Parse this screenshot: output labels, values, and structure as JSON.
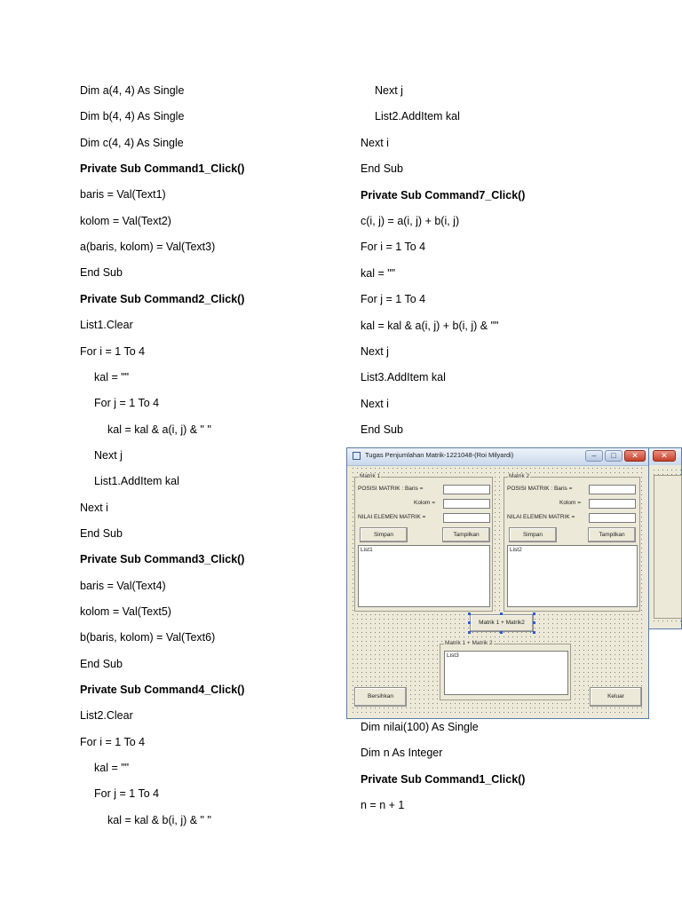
{
  "code_left": [
    {
      "text": "Dim a(4, 4) As Single",
      "bold": false
    },
    {
      "text": "Dim b(4, 4) As Single",
      "bold": false
    },
    {
      "text": "Dim c(4, 4) As Single",
      "bold": false
    },
    {
      "text": "Private Sub Command1_Click()",
      "bold": true
    },
    {
      "text": "baris = Val(Text1)",
      "bold": false
    },
    {
      "text": "kolom = Val(Text2)",
      "bold": false
    },
    {
      "text": "a(baris, kolom) = Val(Text3)",
      "bold": false
    },
    {
      "text": "End Sub",
      "bold": false
    },
    {
      "text": "Private Sub Command2_Click()",
      "bold": true
    },
    {
      "text": "List1.Clear",
      "bold": false
    },
    {
      "text": "For i = 1 To 4",
      "bold": false
    },
    {
      "text": "kal = \"\"",
      "bold": false
    },
    {
      "text": "For j = 1 To 4",
      "bold": false
    },
    {
      "text": "kal = kal & a(i, j) & \" \"",
      "bold": false
    },
    {
      "text": "Next j",
      "bold": false
    },
    {
      "text": "List1.AddItem kal",
      "bold": false
    },
    {
      "text": "Next i",
      "bold": false
    },
    {
      "text": "End Sub",
      "bold": false
    },
    {
      "text": "Private Sub Command3_Click()",
      "bold": true
    },
    {
      "text": "baris = Val(Text4)",
      "bold": false
    },
    {
      "text": "kolom = Val(Text5)",
      "bold": false
    },
    {
      "text": "b(baris, kolom) = Val(Text6)",
      "bold": false
    },
    {
      "text": "End Sub",
      "bold": false
    },
    {
      "text": "Private Sub Command4_Click()",
      "bold": true
    },
    {
      "text": "List2.Clear",
      "bold": false
    },
    {
      "text": "For i = 1 To 4",
      "bold": false
    },
    {
      "text": "kal = \"\"",
      "bold": false
    },
    {
      "text": "For j = 1 To 4",
      "bold": false
    },
    {
      "text": "kal = kal & b(i, j) & \" \"",
      "bold": false
    }
  ],
  "code_right_top": [
    {
      "text": "Next j",
      "bold": false
    },
    {
      "text": "List2.AddItem kal",
      "bold": false
    },
    {
      "text": "Next i",
      "bold": false
    },
    {
      "text": "End Sub",
      "bold": false
    },
    {
      "text": "Private Sub Command7_Click()",
      "bold": true
    },
    {
      "text": "c(i, j) = a(i, j) + b(i, j)",
      "bold": false
    },
    {
      "text": "For i = 1 To 4",
      "bold": false
    },
    {
      "text": "kal = \"\"",
      "bold": false
    },
    {
      "text": "For j = 1 To 4",
      "bold": false
    },
    {
      "text": "kal = kal & a(i, j) + b(i, j) & \"\"",
      "bold": false
    },
    {
      "text": "Next j",
      "bold": false
    },
    {
      "text": "List3.AddItem kal",
      "bold": false
    },
    {
      "text": "Next i",
      "bold": false
    },
    {
      "text": "End Sub",
      "bold": false
    }
  ],
  "code_right_bottom": [
    {
      "text": "Dim nilai(100) As Single",
      "bold": false
    },
    {
      "text": "Dim n As Integer",
      "bold": false
    },
    {
      "text": "Private Sub Command1_Click()",
      "bold": true
    },
    {
      "text": "n = n + 1",
      "bold": false
    }
  ],
  "form": {
    "title": "Tugas Penjumlahan Matrik-1221048-(Roi Milyardi)",
    "min_glyph": "–",
    "max_glyph": "□",
    "close_glyph": "✕",
    "matrix1": {
      "frame": "Matrik 1",
      "pos_label": "POSISI MATRIK : Baris  =",
      "kolom_label": "Kolom =",
      "nilai_label": "NILAI ELEMEN MATRIK =",
      "save": "Simpan",
      "show": "Tampilkan",
      "list": "List1"
    },
    "matrix2": {
      "frame": "Matrik 2",
      "pos_label": "POSISI MATRIK : Baris  =",
      "kolom_label": "Kolom =",
      "nilai_label": "NILAI ELEMEN MATRIK =",
      "save": "Simpan",
      "show": "Tampilkan",
      "list": "List2"
    },
    "add_button": "Matrik 1 + Matrik2",
    "result": {
      "frame": "Matrik 1 + Matrik 2",
      "list": "List3"
    },
    "clear_button": "Bersihkan",
    "exit_button": "Keluar"
  }
}
